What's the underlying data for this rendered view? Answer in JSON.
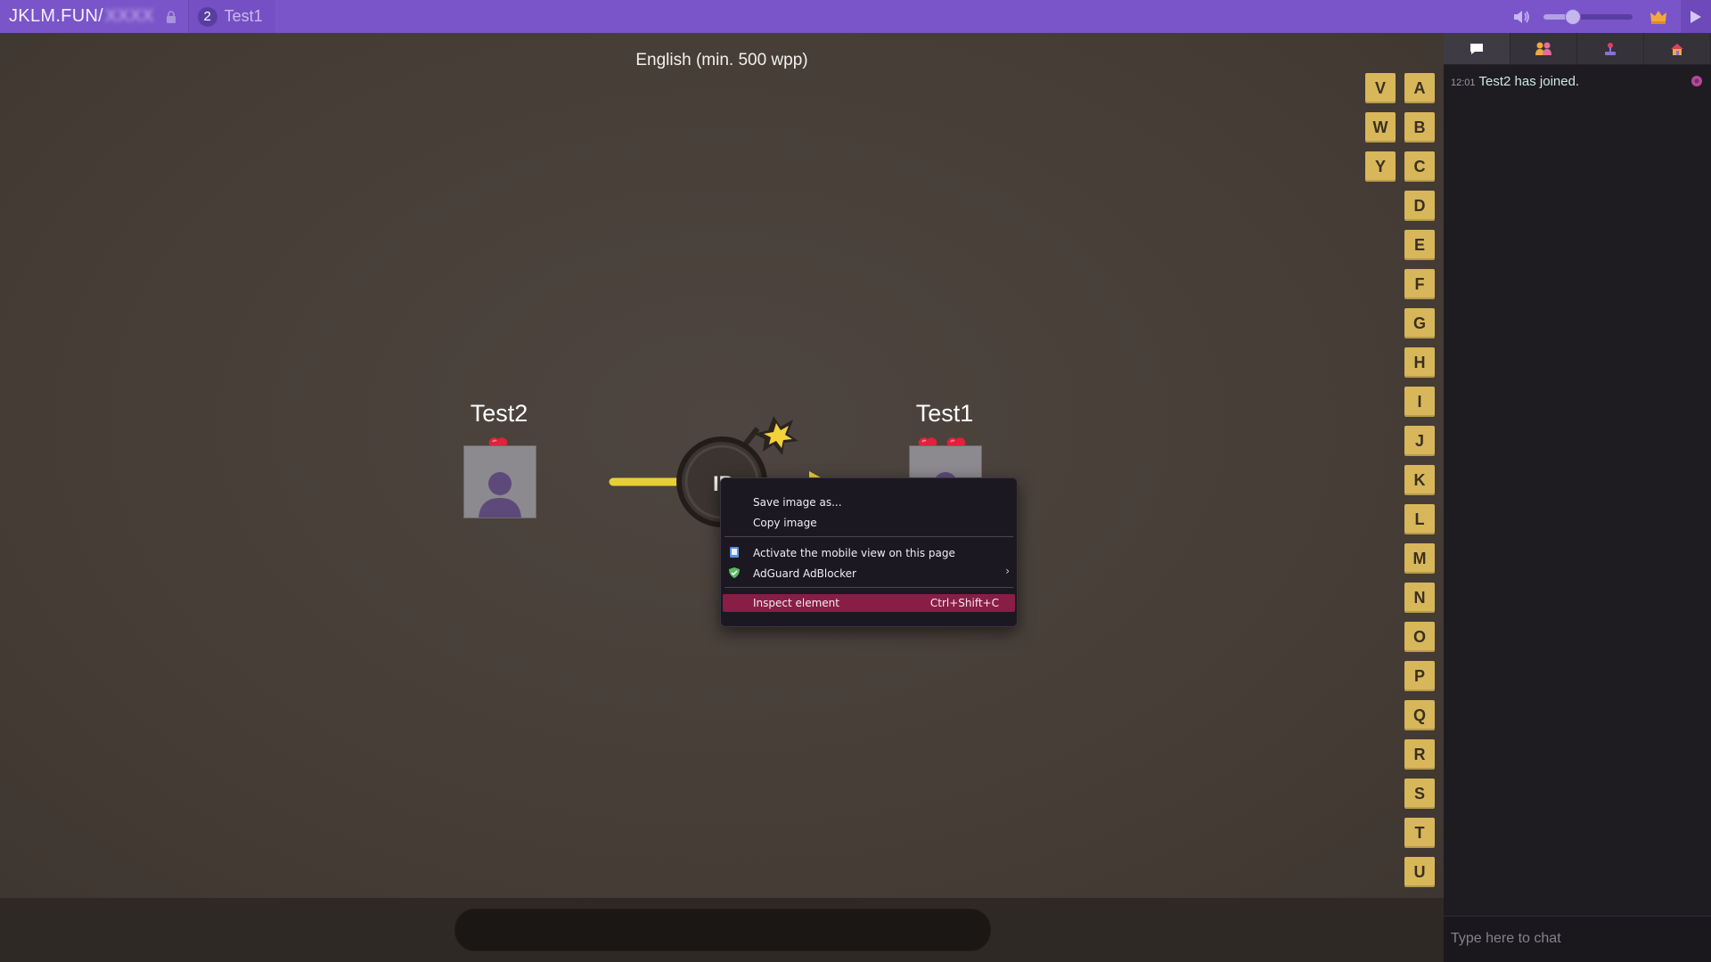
{
  "topbar": {
    "site": "JKLM.FUN/",
    "room_code_hidden": "XXXX",
    "player_count": "2",
    "room_name": "Test1",
    "volume_level": 0.32
  },
  "game": {
    "rules": "English (min. 500 wpp)",
    "letters_right": [
      "A",
      "B",
      "C",
      "D",
      "E",
      "F",
      "G",
      "H",
      "I",
      "J",
      "K",
      "L",
      "M",
      "N",
      "O",
      "P",
      "Q",
      "R",
      "S",
      "T",
      "U"
    ],
    "letters_left": [
      "V",
      "W",
      "Y"
    ],
    "syllable_partial": "IP",
    "players": [
      {
        "name": "Test2",
        "lives": 1
      },
      {
        "name": "Test1",
        "lives": 2
      }
    ]
  },
  "sidebar": {
    "tabs": [
      "chat",
      "players",
      "game-settings",
      "room-settings"
    ],
    "messages": [
      {
        "time": "12:01",
        "text": "Test2 has joined."
      }
    ],
    "chat_placeholder": "Type here to chat"
  },
  "context_menu": {
    "items": {
      "save_image": "Save image as...",
      "copy_image": "Copy image",
      "mobile_view": "Activate the mobile view on this page",
      "adguard": "AdGuard AdBlocker",
      "inspect": "Inspect element",
      "inspect_shortcut": "Ctrl+Shift+C"
    },
    "submenu_arrow": "›"
  },
  "colors": {
    "topbar": "#7a55c9",
    "tile": "#d8b65a",
    "highlight": "#8a1d45"
  }
}
